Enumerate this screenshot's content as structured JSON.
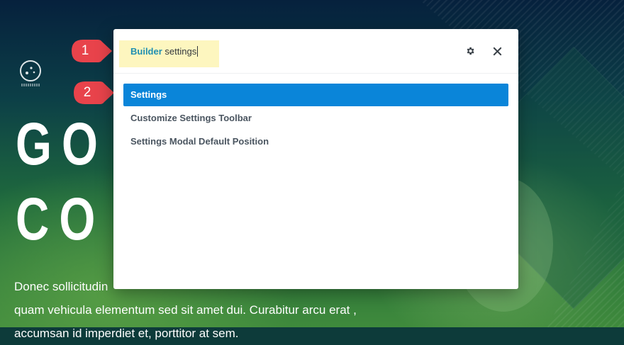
{
  "hero": {
    "title_line1": "GO",
    "title_line2": "CO",
    "body_line1": "Donec sollicitudin",
    "body_line2": "quam vehicula elementum sed sit amet dui. Curabitur arcu erat ,",
    "body_line3": "accumsan id imperdiet et, porttitor at sem."
  },
  "callouts": [
    "1",
    "2"
  ],
  "search": {
    "keyword": "Builder",
    "query_rest": " settings"
  },
  "results": [
    {
      "label": "Settings",
      "active": true
    },
    {
      "label": "Customize Settings Toolbar",
      "active": false
    },
    {
      "label": "Settings Modal Default Position",
      "active": false
    }
  ],
  "icons": {
    "settings": "gear-icon",
    "close": "close-icon",
    "logo": "logo-icon"
  },
  "colors": {
    "accent": "#0a85d9",
    "callout": "#e8434b",
    "highlight": "#fdf6bf"
  }
}
